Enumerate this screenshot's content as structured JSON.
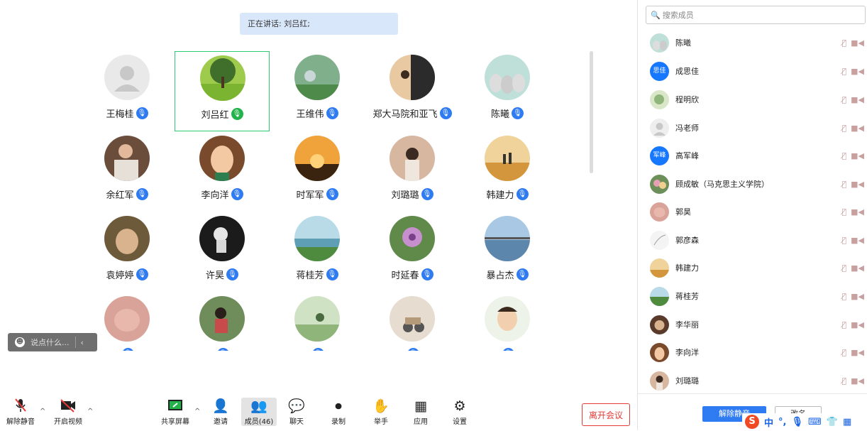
{
  "speaking_banner": "正在讲话: 刘吕红;",
  "participants": [
    {
      "name": "王梅桂",
      "mic": "mic-icon",
      "avatar": "default"
    },
    {
      "name": "刘吕红",
      "mic": "mic-active-icon",
      "avatar": "tree-photo",
      "active": true
    },
    {
      "name": "王维伟",
      "mic": "mic-icon",
      "avatar": "illustration-photo"
    },
    {
      "name": "郑大马院和亚飞",
      "mic": "mic-icon",
      "avatar": "silhouette-photo"
    },
    {
      "name": "陈曦",
      "mic": "mic-icon",
      "avatar": "penguins-photo"
    },
    {
      "name": "余红军",
      "mic": "mic-icon",
      "avatar": "person-photo"
    },
    {
      "name": "李向洋",
      "mic": "mic-icon",
      "avatar": "cartoon-photo"
    },
    {
      "name": "时军军",
      "mic": "mic-icon",
      "avatar": "sunset-photo"
    },
    {
      "name": "刘璐璐",
      "mic": "mic-icon",
      "avatar": "girl-photo"
    },
    {
      "name": "韩建力",
      "mic": "mic-icon",
      "avatar": "desert-photo"
    },
    {
      "name": "袁婷婷",
      "mic": "mic-icon",
      "avatar": "portrait-photo"
    },
    {
      "name": "许昊",
      "mic": "mic-icon",
      "avatar": "astronaut-photo"
    },
    {
      "name": "蒋桂芳",
      "mic": "mic-icon",
      "avatar": "lake-photo"
    },
    {
      "name": "时延春",
      "mic": "mic-icon",
      "avatar": "flower-photo"
    },
    {
      "name": "暴占杰",
      "mic": "mic-icon",
      "avatar": "bridge-photo"
    },
    {
      "name": "",
      "mic": "mic-icon",
      "avatar": "baby-photo"
    },
    {
      "name": "",
      "mic": "mic-icon",
      "avatar": "child-photo"
    },
    {
      "name": "",
      "mic": "mic-icon",
      "avatar": "painting-photo"
    },
    {
      "name": "",
      "mic": "mic-icon",
      "avatar": "scooter-photo"
    },
    {
      "name": "",
      "mic": "mic-icon",
      "avatar": "cartoon-man-photo"
    }
  ],
  "chat_input": {
    "placeholder": "说点什么..."
  },
  "toolbar": {
    "unmute": "解除静音",
    "start_video": "开启视频",
    "share_screen": "共享屏幕",
    "invite": "邀请",
    "members": "成员(46)",
    "chat": "聊天",
    "record": "录制",
    "raise_hand": "举手",
    "apps": "应用",
    "settings": "设置",
    "leave": "离开会议"
  },
  "member_panel": {
    "search_placeholder": "搜索成员",
    "members": [
      {
        "name": "陈曦",
        "avatar_text": ""
      },
      {
        "name": "成思佳",
        "avatar_text": "思佳"
      },
      {
        "name": "程明欣",
        "avatar_text": ""
      },
      {
        "name": "冯老师",
        "avatar_text": ""
      },
      {
        "name": "高军峰",
        "avatar_text": "军峰"
      },
      {
        "name": "顾成敏（马克思主义学院）",
        "avatar_text": ""
      },
      {
        "name": "郭昊",
        "avatar_text": ""
      },
      {
        "name": "郭彦森",
        "avatar_text": ""
      },
      {
        "name": "韩建力",
        "avatar_text": ""
      },
      {
        "name": "蒋桂芳",
        "avatar_text": ""
      },
      {
        "name": "李华丽",
        "avatar_text": ""
      },
      {
        "name": "李向洋",
        "avatar_text": ""
      },
      {
        "name": "刘璐璐",
        "avatar_text": ""
      }
    ],
    "unmute_all": "解除静音",
    "rename": "改名"
  },
  "ime_bar": {
    "lang": "中"
  },
  "colors": {
    "accent": "#2f7bf1",
    "active_border": "#2ecc71",
    "leave": "#e53935"
  }
}
